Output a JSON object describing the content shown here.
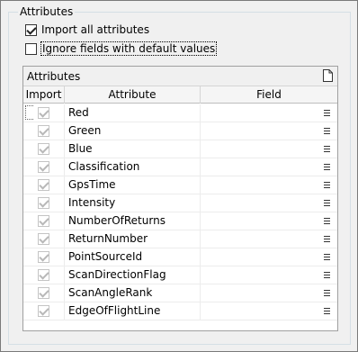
{
  "group": {
    "title": "Attributes"
  },
  "options": {
    "import_all": {
      "label": "Import all attributes",
      "checked": true
    },
    "ignore_defaults": {
      "label": "Ignore fields with default values",
      "checked": false
    }
  },
  "panel": {
    "title": "Attributes",
    "icon": "document-icon",
    "columns": {
      "import": "Import",
      "attribute": "Attribute",
      "field": "Field"
    }
  },
  "rows": [
    {
      "attribute": "Red",
      "import": true
    },
    {
      "attribute": "Green",
      "import": true
    },
    {
      "attribute": "Blue",
      "import": true
    },
    {
      "attribute": "Classification",
      "import": true
    },
    {
      "attribute": "GpsTime",
      "import": true
    },
    {
      "attribute": "Intensity",
      "import": true
    },
    {
      "attribute": "NumberOfReturns",
      "import": true
    },
    {
      "attribute": "ReturnNumber",
      "import": true
    },
    {
      "attribute": "PointSourceId",
      "import": true
    },
    {
      "attribute": "ScanDirectionFlag",
      "import": true
    },
    {
      "attribute": "ScanAngleRank",
      "import": true
    },
    {
      "attribute": "EdgeOfFlightLine",
      "import": true
    }
  ]
}
